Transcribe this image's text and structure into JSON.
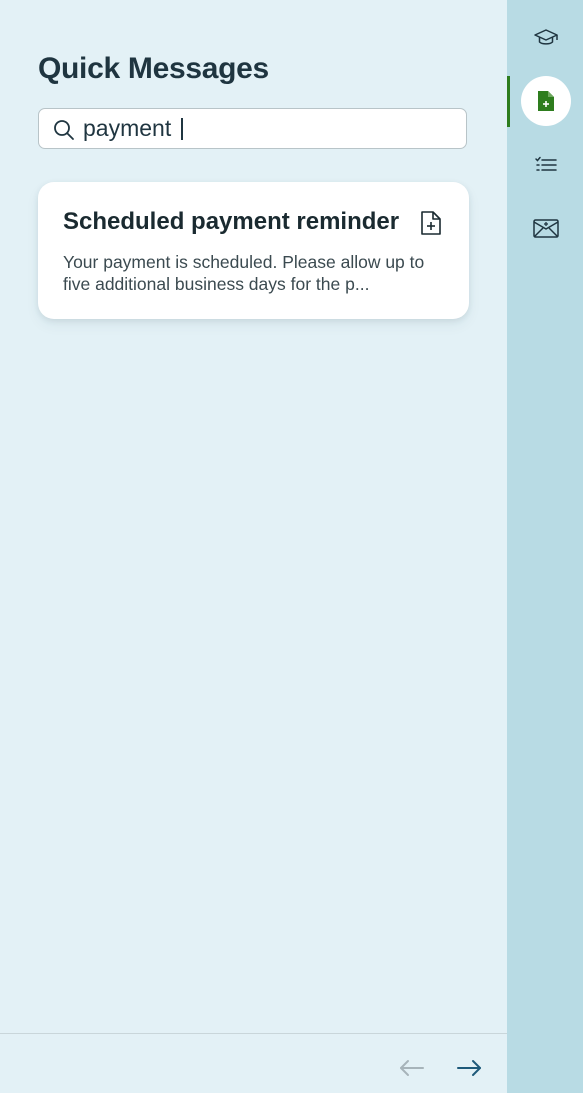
{
  "panel": {
    "title": "Quick Messages"
  },
  "search": {
    "value": "payment",
    "placeholder": "Search"
  },
  "results": [
    {
      "title": "Scheduled payment reminder",
      "preview": "Your payment is scheduled. Please allow up to five additional business days for the p..."
    }
  ],
  "footer": {
    "prev_icon": "arrow-left-icon",
    "next_icon": "arrow-right-icon"
  },
  "sidebar": {
    "items": [
      {
        "icon": "graduation-cap-icon",
        "active": false
      },
      {
        "icon": "file-plus-icon",
        "active": true
      },
      {
        "icon": "checklist-icon",
        "active": false
      },
      {
        "icon": "envelope-x-icon",
        "active": false
      }
    ]
  },
  "colors": {
    "background": "#e3f1f6",
    "sidebar": "#b8dbe4",
    "accent": "#2e7d1e",
    "nav_enabled": "#1e5a7a",
    "nav_disabled": "#a7b4ba"
  }
}
